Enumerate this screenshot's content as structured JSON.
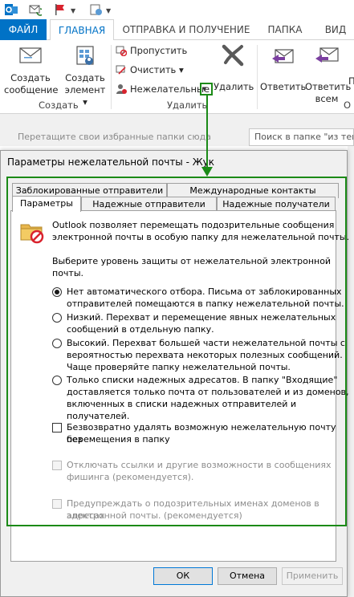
{
  "ribbon_tabs": {
    "file": "ФАЙЛ",
    "home": "ГЛАВНАЯ",
    "send_receive": "ОТПРАВКА И ПОЛУЧЕНИЕ",
    "folder": "ПАПКА",
    "view": "ВИД"
  },
  "ribbon": {
    "new_message_line1": "Создать",
    "new_message_line2": "сообщение",
    "new_items_line1": "Создать",
    "new_items_line2": "элемент ▾",
    "group_new": "Создать",
    "ignore": "Пропустить",
    "clean_up": "Очистить ▾",
    "junk": "Нежелательные",
    "delete": "Удалить",
    "group_delete": "Удалить",
    "reply": "Ответить",
    "reply_all_line1": "Ответить",
    "reply_all_line2": "всем",
    "forward_partial": "П",
    "group_respond_partial": "О"
  },
  "subbar": {
    "favorites_hint": "Перетащите свои избранные папки сюда",
    "search_placeholder": "Поиск в папке \"из теку"
  },
  "dialog": {
    "title": "Параметры нежелательной почты - Жук",
    "tabs": {
      "blocked_senders": "Заблокированные отправители",
      "international": "Международные контакты",
      "options": "Параметры",
      "safe_senders": "Надежные отправители",
      "safe_recipients": "Надежные получатели"
    },
    "intro_line1": "Outlook позволяет перемещать подозрительные сообщения",
    "intro_line2": "электронной почты в особую папку для нежелательной почты.",
    "level_line1": "Выберите уровень защиты от нежелательной электронной",
    "level_line2": "почты.",
    "options": [
      {
        "l1": "Нет автоматического отбора. Письма от заблокированных",
        "l2": "отправителей помещаются в папку нежелательной почты.",
        "l3": "",
        "l4": "",
        "selected": true
      },
      {
        "l1": "Низкий. Перехват и перемещение явных нежелательных",
        "l2": "сообщений в отдельную папку.",
        "l3": "",
        "l4": "",
        "selected": false
      },
      {
        "l1": "Высокий. Перехват большей части нежелательной почты с",
        "l2": "вероятностью перехвата некоторых полезных сообщений.",
        "l3": "Чаще проверяйте папку нежелательной почты.",
        "l4": "",
        "selected": false
      },
      {
        "l1": "Только списки надежных адресатов. В папку \"Входящие\"",
        "l2": "доставляется только почта от пользователей и из доменов,",
        "l3": "включенных в списки надежных отправителей и получателей.",
        "l4": "",
        "selected": false
      }
    ],
    "delete_permanently_l1": "Безвозвратно удалять возможную нежелательную почту без",
    "delete_permanently_l2": "перемещения в папку",
    "phishing_l1": "Отключать ссылки и другие возможности в сообщениях",
    "phishing_l2": "фишинга (рекомендуется).",
    "domains_l1": "Предупреждать о подозрительных именах доменов в адресах",
    "domains_l2": "электронной почты. (рекомендуется)",
    "ok": "ОК",
    "cancel": "Отмена",
    "apply": "Применить"
  },
  "colors": {
    "accent": "#0072c6",
    "highlight": "#1b8a17"
  }
}
